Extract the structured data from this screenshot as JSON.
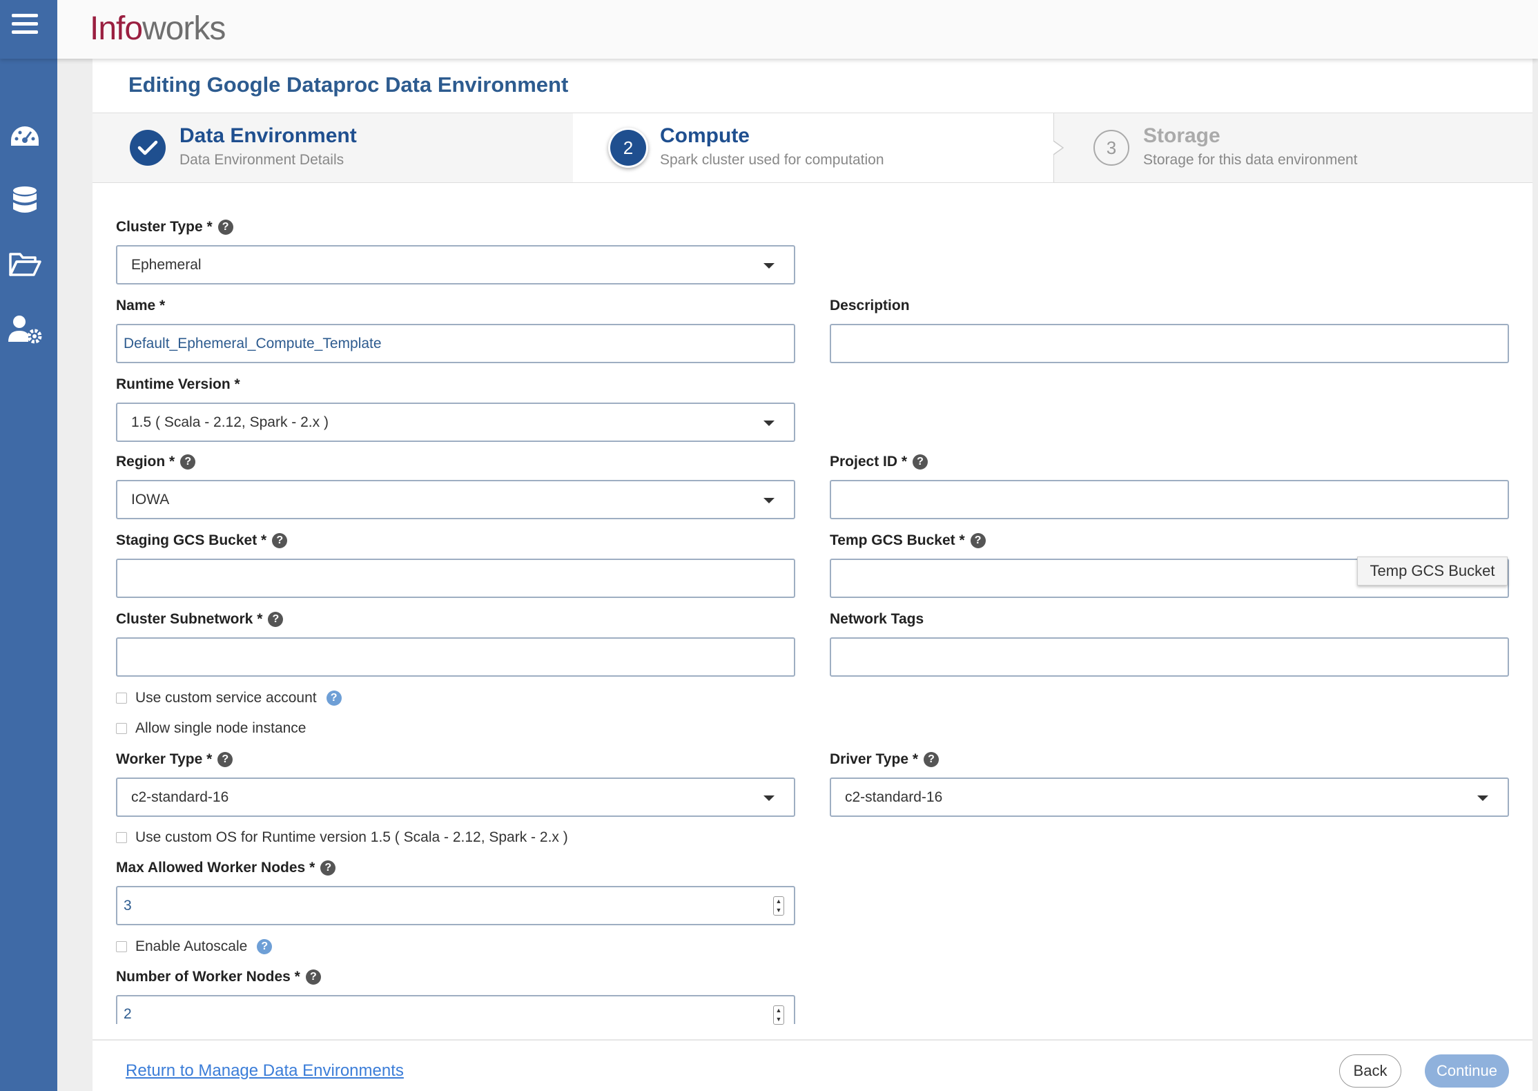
{
  "header": {
    "logo_part1": "Info",
    "logo_part2": "works"
  },
  "sidebar": {
    "items": [
      {
        "icon": "dashboard-icon"
      },
      {
        "icon": "database-icon"
      },
      {
        "icon": "folder-icon"
      },
      {
        "icon": "user-settings-icon"
      }
    ]
  },
  "page": {
    "title": "Editing Google Dataproc Data Environment"
  },
  "steps": [
    {
      "number": "",
      "title": "Data Environment",
      "subtitle": "Data Environment Details",
      "state": "done"
    },
    {
      "number": "2",
      "title": "Compute",
      "subtitle": "Spark cluster used for computation",
      "state": "active"
    },
    {
      "number": "3",
      "title": "Storage",
      "subtitle": "Storage for this data environment",
      "state": "pending"
    }
  ],
  "form": {
    "cluster_type": {
      "label": "Cluster Type",
      "required": "*",
      "value": "Ephemeral"
    },
    "name": {
      "label": "Name",
      "required": "*",
      "value": "Default_Ephemeral_Compute_Template"
    },
    "description": {
      "label": "Description",
      "value": ""
    },
    "runtime_version": {
      "label": "Runtime Version",
      "required": "*",
      "value": "1.5 ( Scala - 2.12, Spark - 2.x )"
    },
    "region": {
      "label": "Region",
      "required": "*",
      "value": "IOWA"
    },
    "project_id": {
      "label": "Project ID",
      "required": "*",
      "value": ""
    },
    "staging_gcs_bucket": {
      "label": "Staging GCS Bucket",
      "required": "*",
      "value": ""
    },
    "temp_gcs_bucket": {
      "label": "Temp GCS Bucket",
      "required": "*",
      "value": "",
      "tooltip": "Temp GCS Bucket"
    },
    "cluster_subnetwork": {
      "label": "Cluster Subnetwork",
      "required": "*",
      "value": ""
    },
    "network_tags": {
      "label": "Network Tags",
      "value": ""
    },
    "use_custom_service_account": {
      "label": "Use custom service account",
      "checked": false
    },
    "allow_single_node": {
      "label": "Allow single node instance",
      "checked": false
    },
    "worker_type": {
      "label": "Worker Type",
      "required": "*",
      "value": "c2-standard-16"
    },
    "driver_type": {
      "label": "Driver Type",
      "required": "*",
      "value": "c2-standard-16"
    },
    "use_custom_os": {
      "label": "Use custom OS for Runtime version 1.5 ( Scala - 2.12, Spark - 2.x )",
      "checked": false
    },
    "max_worker_nodes": {
      "label": "Max Allowed Worker Nodes",
      "required": "*",
      "value": "3"
    },
    "enable_autoscale": {
      "label": "Enable Autoscale",
      "checked": false
    },
    "num_worker_nodes": {
      "label": "Number of Worker Nodes",
      "required": "*",
      "value": "2"
    }
  },
  "help_glyph": "?",
  "footer": {
    "return_link": "Return to Manage Data Environments",
    "back_label": "Back",
    "continue_label": "Continue"
  },
  "colors": {
    "sidebar": "#3f6aa6",
    "title_blue": "#2d5b8f",
    "active_step": "#1f4f8f",
    "link": "#3b7dd8",
    "continue_button": "#8fb1dc",
    "logo_red": "#9a1f40"
  }
}
